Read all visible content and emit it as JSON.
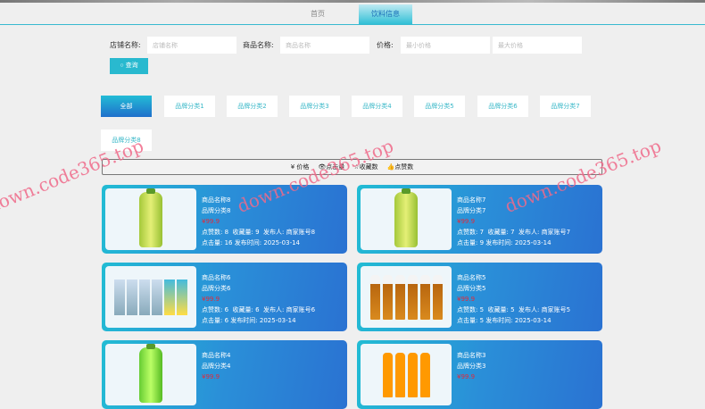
{
  "nav": {
    "tabs": [
      {
        "label": "首页"
      },
      {
        "label": "饮料信息"
      }
    ]
  },
  "search": {
    "shop_label": "店铺名称:",
    "shop_placeholder": "店铺名称",
    "goods_label": "商品名称:",
    "goods_placeholder": "商品名称",
    "price_label": "价格:",
    "min_placeholder": "最小价格",
    "max_placeholder": "最大价格",
    "query_label": "查询"
  },
  "categories": [
    "全部",
    "品牌分类1",
    "品牌分类2",
    "品牌分类3",
    "品牌分类4",
    "品牌分类5",
    "品牌分类6",
    "品牌分类7",
    "品牌分类8"
  ],
  "sort": {
    "price": "¥ 价格",
    "clicks": "点击量",
    "favorites": "收藏数",
    "likes": "点赞数"
  },
  "products": [
    {
      "name": "商品名称8",
      "category": "品牌分类8",
      "price": "¥99.9",
      "likes": "点赞数: 8",
      "favs": "收藏量: 9",
      "publisher": "发布人: 商家账号8",
      "clicks": "点击量: 16",
      "date": "发布时间: 2025-03-14"
    },
    {
      "name": "商品名称7",
      "category": "品牌分类7",
      "price": "¥99.9",
      "likes": "点赞数: 7",
      "favs": "收藏量: 7",
      "publisher": "发布人: 商家账号7",
      "clicks": "点击量: 9",
      "date": "发布时间: 2025-03-14"
    },
    {
      "name": "商品名称6",
      "category": "品牌分类6",
      "price": "¥99.9",
      "likes": "点赞数: 6",
      "favs": "收藏量: 6",
      "publisher": "发布人: 商家账号6",
      "clicks": "点击量: 6",
      "date": "发布时间: 2025-03-14"
    },
    {
      "name": "商品名称5",
      "category": "品牌分类5",
      "price": "¥99.9",
      "likes": "点赞数: 5",
      "favs": "收藏量: 5",
      "publisher": "发布人: 商家账号5",
      "clicks": "点击量: 5",
      "date": "发布时间: 2025-03-14"
    },
    {
      "name": "商品名称4",
      "category": "品牌分类4",
      "price": "¥99.9"
    },
    {
      "name": "商品名称3",
      "category": "品牌分类3",
      "price": "¥99.9"
    }
  ],
  "watermark": "down.code365.top"
}
